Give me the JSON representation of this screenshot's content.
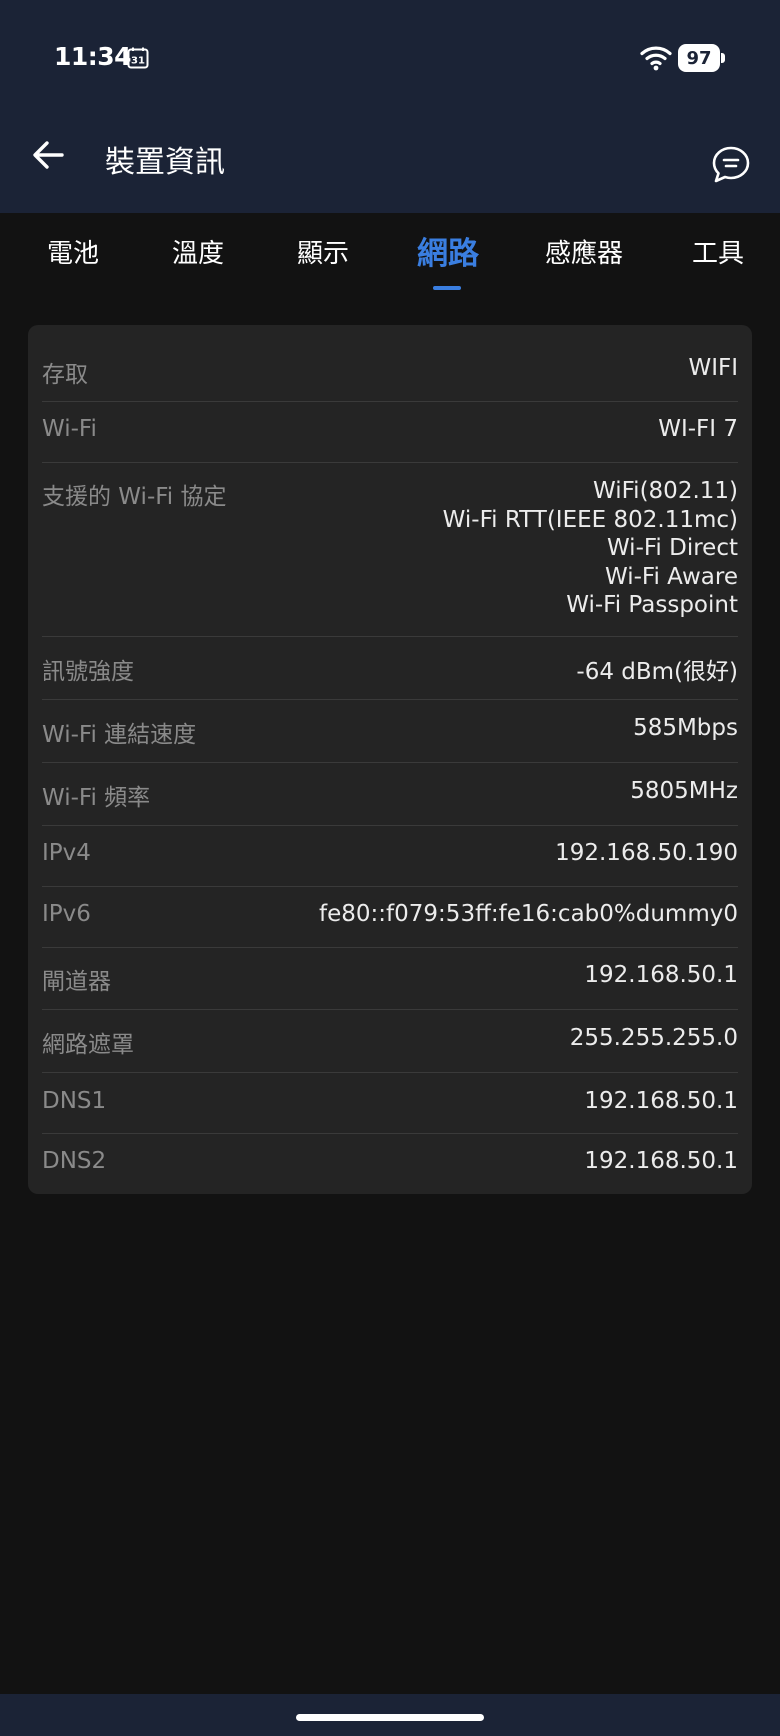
{
  "status_bar": {
    "time": "11:34",
    "calendar_day": "31",
    "battery": "97"
  },
  "app_bar": {
    "title": "裝置資訊"
  },
  "tabs": [
    {
      "label": "電池",
      "active": false
    },
    {
      "label": "溫度",
      "active": false
    },
    {
      "label": "顯示",
      "active": false
    },
    {
      "label": "網路",
      "active": true
    },
    {
      "label": "感應器",
      "active": false
    },
    {
      "label": "工具",
      "active": false
    }
  ],
  "network": {
    "rows": [
      {
        "label": "存取",
        "value": "WIFI"
      },
      {
        "label": "Wi-Fi",
        "value": "WI-FI 7"
      },
      {
        "label": "支援的 Wi-Fi 協定",
        "values": [
          "WiFi(802.11)",
          "Wi-Fi RTT(IEEE 802.11mc)",
          "Wi-Fi Direct",
          "Wi-Fi Aware",
          "Wi-Fi Passpoint"
        ]
      },
      {
        "label": "訊號強度",
        "value": "-64 dBm(很好)"
      },
      {
        "label": "Wi-Fi 連結速度",
        "value": "585Mbps"
      },
      {
        "label": "Wi-Fi 頻率",
        "value": "5805MHz"
      },
      {
        "label": "IPv4",
        "value": "192.168.50.190"
      },
      {
        "label": "IPv6",
        "value": "fe80::f079:53ff:fe16:cab0%dummy0"
      },
      {
        "label": "閘道器",
        "value": "192.168.50.1"
      },
      {
        "label": "網路遮罩",
        "value": "255.255.255.0"
      },
      {
        "label": "DNS1",
        "value": "192.168.50.1"
      },
      {
        "label": "DNS2",
        "value": "192.168.50.1"
      }
    ]
  },
  "colors": {
    "header_bg": "#1b2336",
    "accent": "#3a7ee0",
    "card_bg": "#242424",
    "page_bg": "#121212"
  }
}
